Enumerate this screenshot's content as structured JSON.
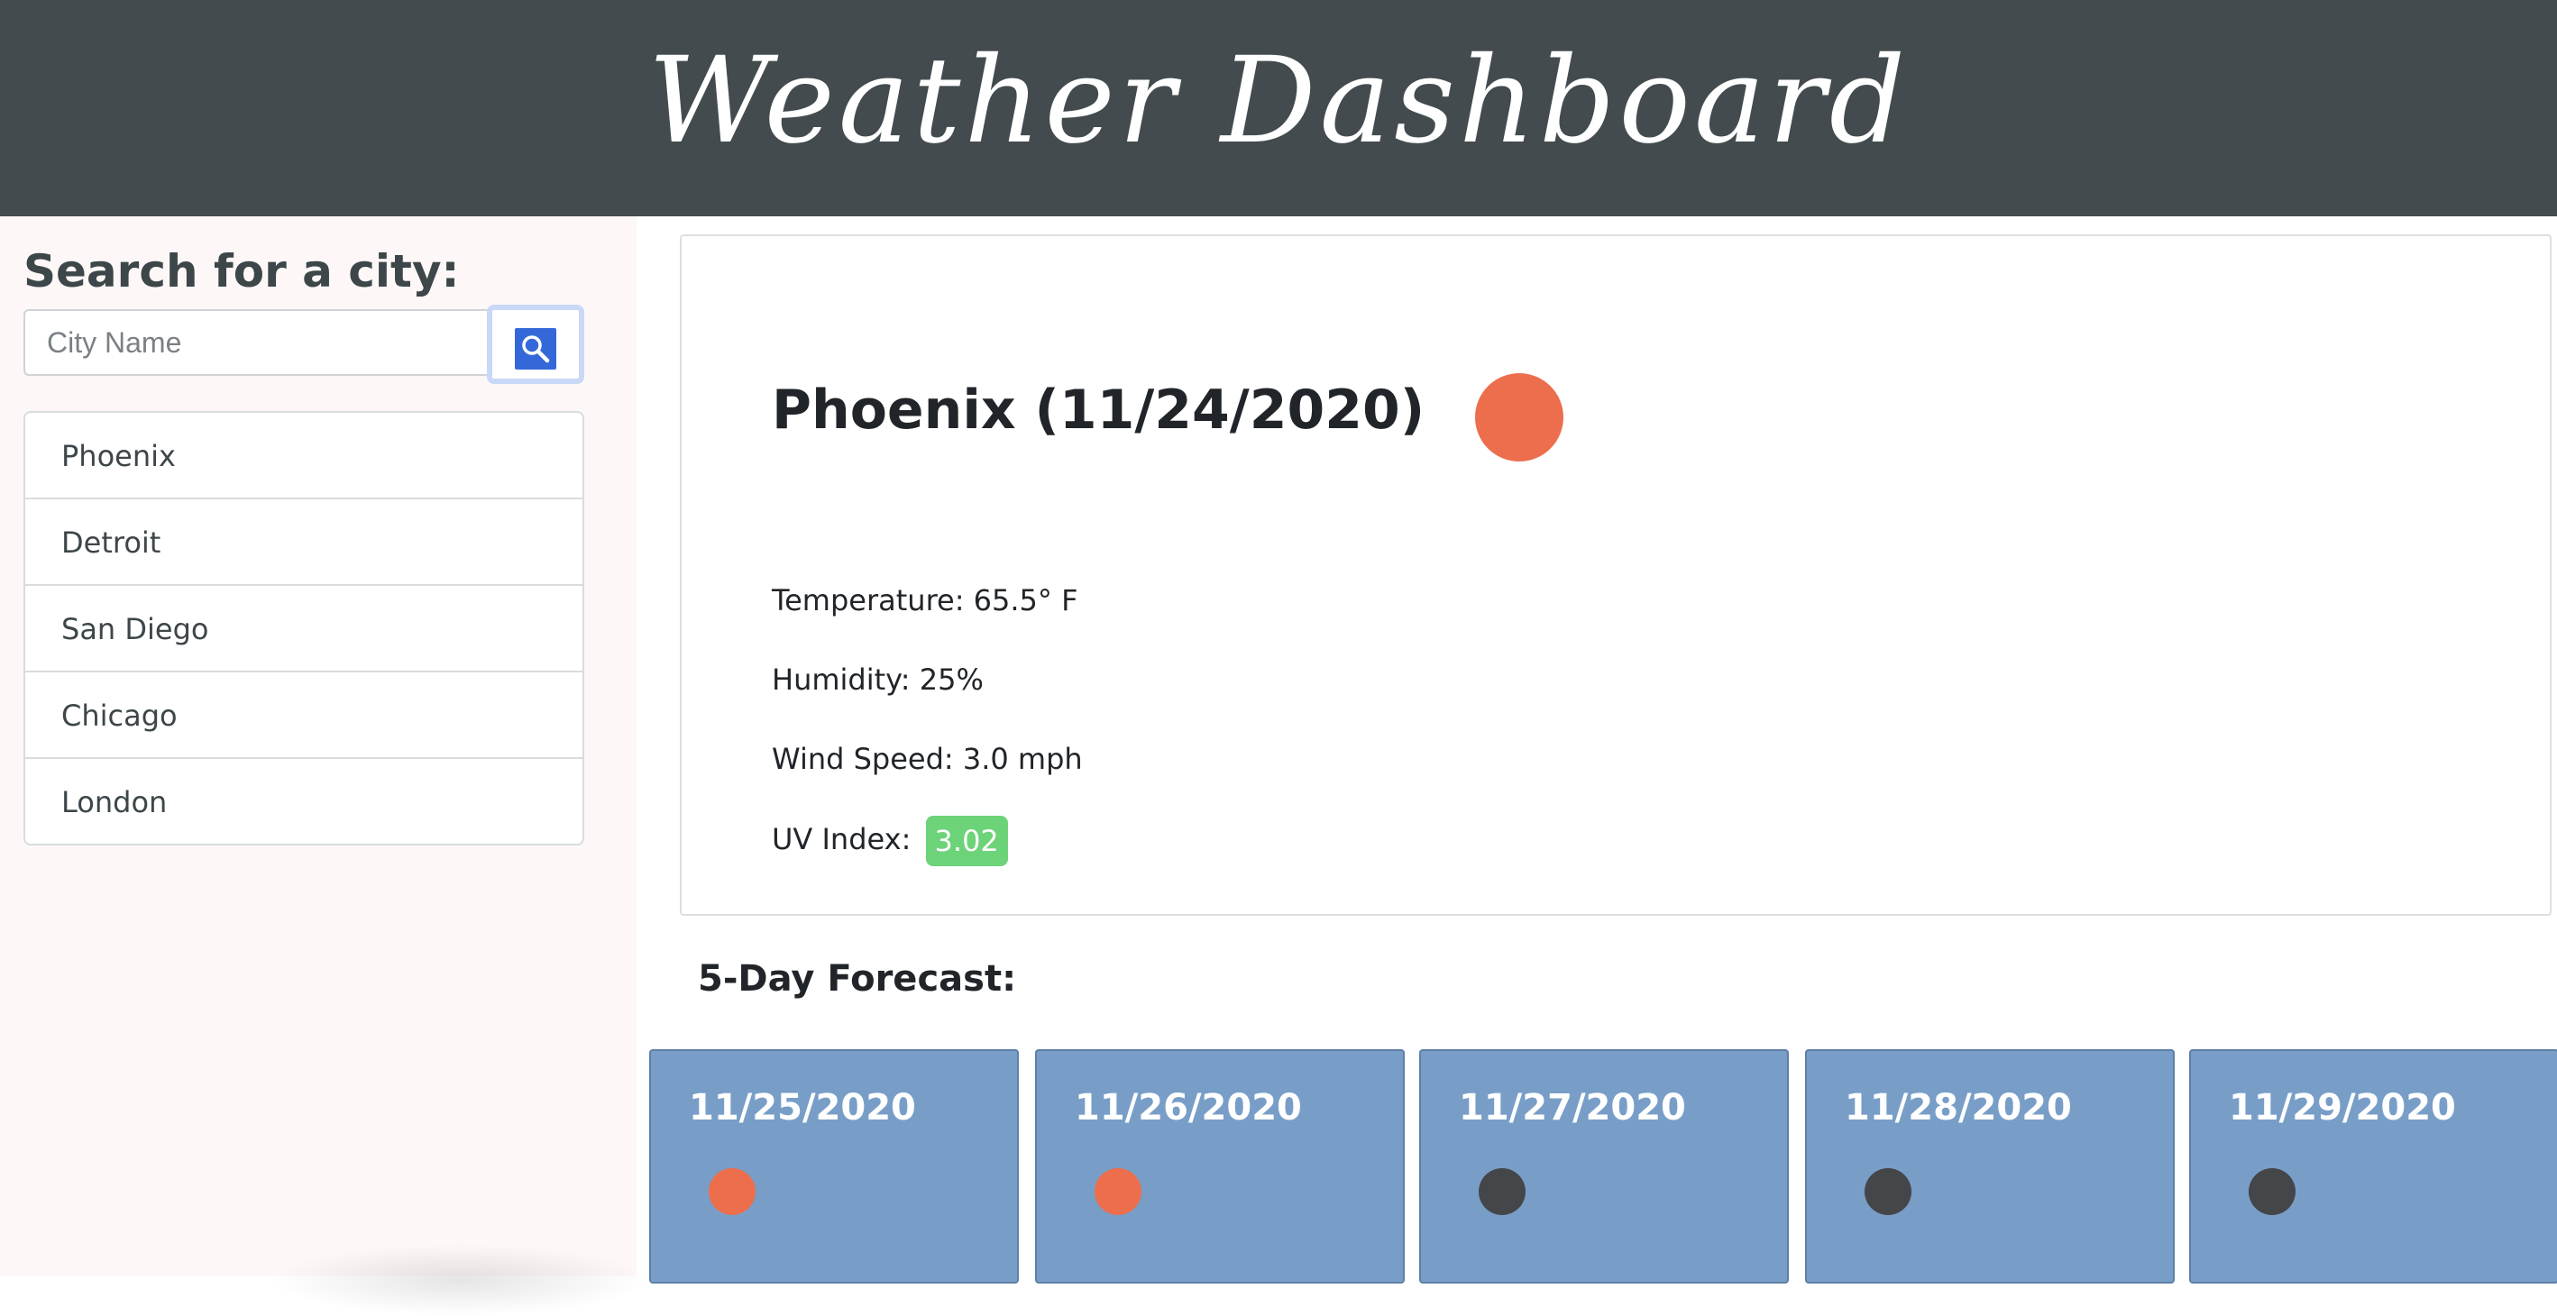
{
  "header": {
    "title": "Weather Dashboard"
  },
  "sidebar": {
    "heading": "Search for a city:",
    "search": {
      "placeholder": "City Name",
      "value": ""
    },
    "cities": [
      "Phoenix",
      "Detroit",
      "San Diego",
      "Chicago",
      "London"
    ]
  },
  "current": {
    "title": "Phoenix (11/24/2020)",
    "icon": "sun-icon",
    "temperature": "Temperature: 65.5° F",
    "humidity": "Humidity: 25%",
    "wind": "Wind Speed: 3.0 mph",
    "uv_label": "UV Index:",
    "uv_value": "3.02"
  },
  "forecast": {
    "heading": "5-Day Forecast:",
    "days": [
      {
        "date": "11/25/2020",
        "icon": "sun-icon"
      },
      {
        "date": "11/26/2020",
        "icon": "sun-icon"
      },
      {
        "date": "11/27/2020",
        "icon": "cloud-icon"
      },
      {
        "date": "11/28/2020",
        "icon": "cloud-icon"
      },
      {
        "date": "11/29/2020",
        "icon": "cloud-icon"
      }
    ]
  },
  "colors": {
    "header_bg": "#434b4e",
    "sidebar_bg": "#fdf8f7",
    "search_button": "#3468d9",
    "uv_badge": "#6dd378",
    "forecast_card": "#789ec8",
    "sun_icon": "#ec6e4c",
    "cloud_icon": "#444649"
  }
}
